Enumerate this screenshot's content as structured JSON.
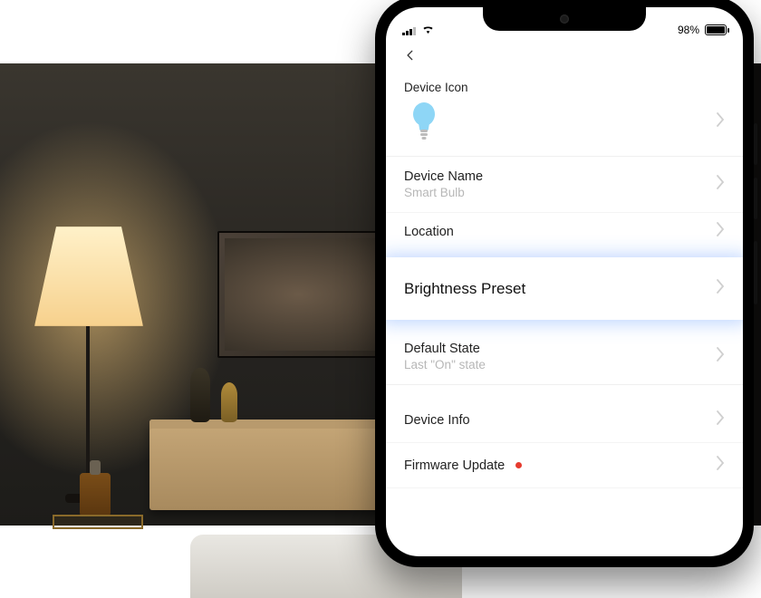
{
  "status": {
    "battery_pct": "98%"
  },
  "labels": {
    "device_icon": "Device Icon",
    "device_name": "Device Name",
    "device_name_value": "Smart Bulb",
    "location": "Location",
    "brightness_preset": "Brightness Preset",
    "default_state": "Default State",
    "default_state_value": "Last \"On\" state",
    "device_info": "Device Info",
    "firmware_update": "Firmware Update"
  },
  "icons": {
    "bulb_fill": "#8ed6f6",
    "bulb_base": "#bcbcbc"
  }
}
